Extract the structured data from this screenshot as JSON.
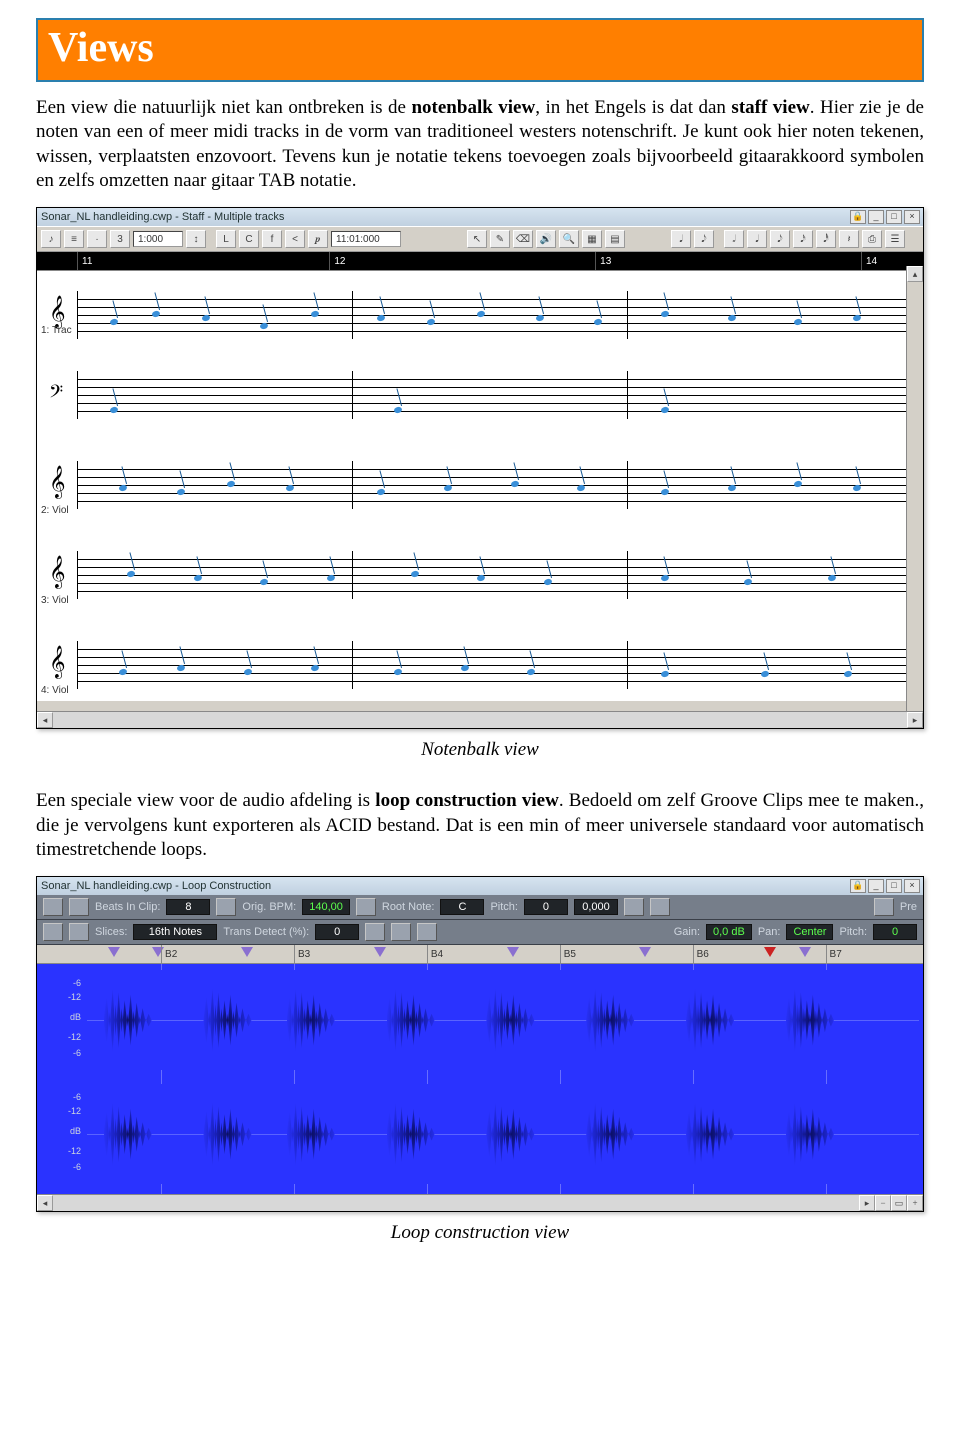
{
  "banner": {
    "title": "Views"
  },
  "para1_a": "Een view die natuurlijk niet kan ontbreken is de ",
  "para1_bold1": "notenbalk view",
  "para1_b": ", in het Engels is dat dan ",
  "para1_bold2": "staff view",
  "para1_c": ". Hier zie je de noten van een of meer midi tracks in de vorm van traditioneel westers notenschrift. Je kunt ook hier noten tekenen, wissen, verplaatsten enzovoort. Tevens kun je notatie tekens toevoegen zoals bijvoorbeeld gitaarakkoord symbolen en zelfs omzetten naar gitaar TAB notatie.",
  "caption1": "Notenbalk view",
  "para2_a": "Een speciale view voor de audio afdeling is ",
  "para2_bold": "loop construction view",
  "para2_b": ". Bedoeld om zelf Groove Clips mee te maken., die je vervolgens kunt exporteren als ACID bestand. Dat is een min of meer universele standaard voor automatisch  timestretchende loops.",
  "caption2": "Loop construction view",
  "staffshot": {
    "title": "Sonar_NL handleiding.cwp - Staff - Multiple tracks",
    "toolbar": {
      "zoom_value": "1:000",
      "timecode": "11:01:000",
      "glyphs": [
        "L",
        "C",
        "f",
        "<",
        "𝆏"
      ]
    },
    "ruler": [
      "11",
      "12",
      "13",
      "14"
    ],
    "tracks": [
      {
        "clef": "𝄞",
        "label": "1: Trac"
      },
      {
        "clef": "𝄢",
        "label": ""
      },
      {
        "clef": "𝄞",
        "label": "2: Viol"
      },
      {
        "clef": "𝄞",
        "label": "3: Viol"
      },
      {
        "clef": "𝄞",
        "label": "4: Viol"
      }
    ]
  },
  "loopshot": {
    "title": "Sonar_NL handleiding.cwp - Loop Construction",
    "row1": {
      "beats_label": "Beats In Clip:",
      "beats_value": "8",
      "bpm_label": "Orig. BPM:",
      "bpm_value": "140,00",
      "root_label": "Root Note:",
      "root_value": "C",
      "pitch_label": "Pitch:",
      "pitch_value": "0",
      "pitch_fine": "0,000",
      "pre_label": "Pre"
    },
    "row2": {
      "slices_label": "Slices:",
      "slices_value": "16th Notes",
      "trans_label": "Trans Detect (%):",
      "trans_value": "0",
      "gain_label": "Gain:",
      "gain_value": "0,0 dB",
      "pan_label": "Pan:",
      "pan_value": "Center",
      "pitch2_label": "Pitch:",
      "pitch2_value": "0"
    },
    "ruler": [
      "B2",
      "B3",
      "B4",
      "B5",
      "B6",
      "B7"
    ],
    "db_ticks": [
      "-6",
      "-12",
      "dB",
      "-12",
      "-6"
    ]
  }
}
